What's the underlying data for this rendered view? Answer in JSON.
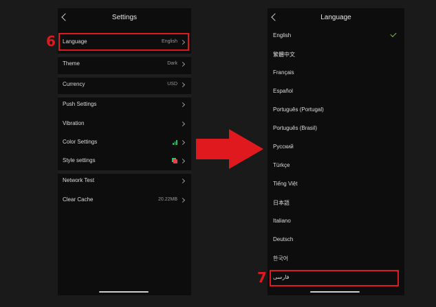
{
  "colors": {
    "highlight": "#e0191f",
    "accent_green": "#2fbf71",
    "check": "#7bbf3a",
    "background": "#0d0d0d"
  },
  "settings": {
    "title": "Settings",
    "back_icon": "chevron-left-icon",
    "rows": [
      {
        "label": "Language",
        "value": "English"
      },
      {
        "label": "Theme",
        "value": "Dark"
      },
      {
        "label": "Currency",
        "value": "USD"
      },
      {
        "label": "Push Settings",
        "value": ""
      },
      {
        "label": "Vibration",
        "value": ""
      },
      {
        "label": "Color Settings",
        "value": "",
        "icon": "color-bars-icon"
      },
      {
        "label": "Style settings",
        "value": "",
        "icon": "style-squares-icon"
      },
      {
        "label": "Network Test",
        "value": ""
      },
      {
        "label": "Clear Cache",
        "value": "20.22MB"
      }
    ]
  },
  "language": {
    "title": "Language",
    "back_icon": "chevron-left-icon",
    "selected": "English",
    "items": [
      "English",
      "繁體中文",
      "Français",
      "Español",
      "Português (Portugal)",
      "Português (Brasil)",
      "Русский",
      "Türkçe",
      "Tiếng Việt",
      "日本語",
      "Italiano",
      "Deutsch",
      "한국어",
      "فارسی"
    ]
  },
  "annotations": {
    "step_6": "6",
    "step_7": "7",
    "arrow_icon": "right-arrow-icon"
  }
}
